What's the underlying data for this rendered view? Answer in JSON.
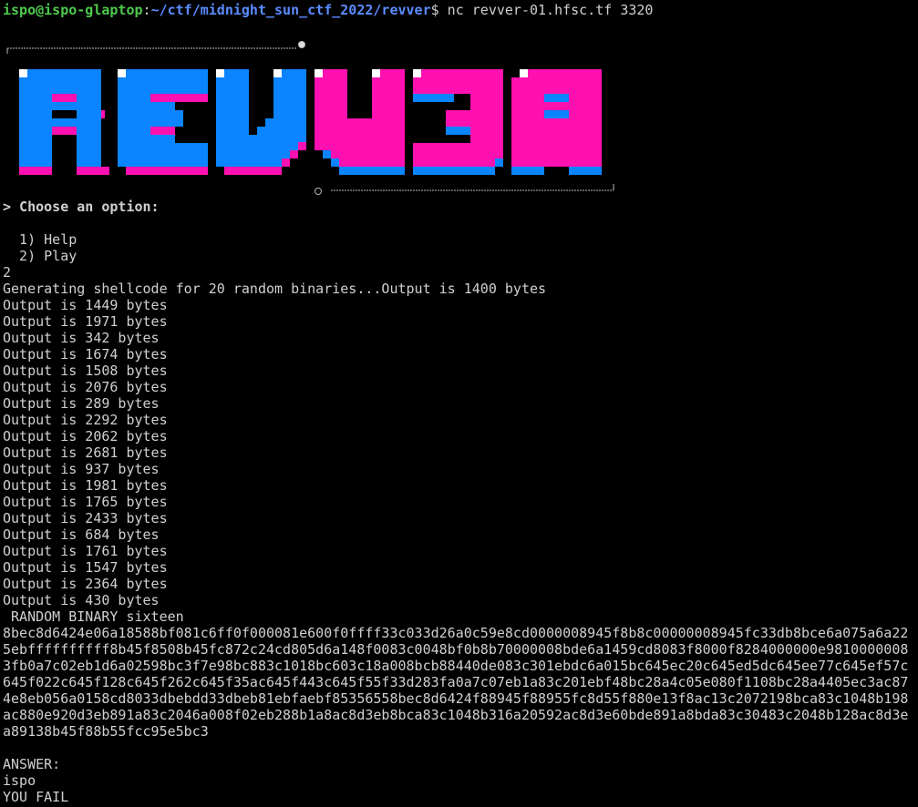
{
  "prompt": {
    "user_host": "ispo@ispo-glaptop",
    "separator": ":",
    "path": "~/ctf/midnight_sun_ctf_2022/revver",
    "symbol": "$ ",
    "command": "nc revver-01.hfsc.tf 3320"
  },
  "banner": {
    "logo_text": "REVV3R",
    "colors": {
      "blue": "#0a84ff",
      "pink": "#ff10b0",
      "white": "#ffffff"
    }
  },
  "menu": {
    "heading": "> Choose an option:",
    "options": [
      "  1) Help",
      "  2) Play"
    ]
  },
  "session": {
    "choice": "2",
    "generating": "Generating shellcode for 20 random binaries...Output is 1400 bytes",
    "outputs": [
      "Output is 1449 bytes",
      "Output is 1971 bytes",
      "Output is 342 bytes",
      "Output is 1674 bytes",
      "Output is 1508 bytes",
      "Output is 2076 bytes",
      "Output is 289 bytes",
      "Output is 2292 bytes",
      "Output is 2062 bytes",
      "Output is 2681 bytes",
      "Output is 937 bytes",
      "Output is 1981 bytes",
      "Output is 1765 bytes",
      "Output is 2433 bytes",
      "Output is 684 bytes",
      "Output is 1761 bytes",
      "Output is 1547 bytes",
      "Output is 2364 bytes",
      "Output is 430 bytes"
    ],
    "random_binary_label": " RANDOM BINARY sixteen",
    "hex_dump": "8bec8d6424e06a18588bf081c6ff0f000081e600f0ffff33c033d26a0c59e8cd0000008945f8b8c00000008945fc33db8bce6a075a6a225ebffffffffff8b45f8508b45fc872c24cd805d6a148f0083c0048bf0b8b70000008bde6a1459cd8083f8000f8284000000e98100000083fb0a7c02eb1d6a02598bc3f7e98bc883c1018bc603c18a008bcb88440de083c301ebdc6a015bc645ec20c645ed5dc645ee77c645ef57c645f022c645f128c645f262c645f35ac645f443c645f55f33d283fa0a7c07eb1a83c201ebf48bc28a4c05e080f1108bc28a4405ec3ac874e8eb056a0158cd8033dbebdd33dbeb81ebfaebf85356558bec8d6424f88945f88955fc8d55f880e13f8ac13c2072198bca83c1048b198ac880e920d3eb891a83c2046a008f02eb288b1a8ac8d3eb8bca83c1048b316a20592ac8d3e60bde891a8bda83c30483c2048b128ac8d3ea89138b45f88b55fcc95e5bc3",
    "answer_label": "ANSWER:",
    "answer_value": "ispo",
    "result": "YOU FAIL"
  }
}
